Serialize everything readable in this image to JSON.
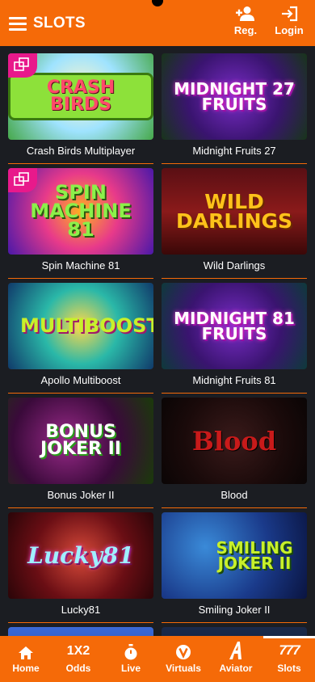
{
  "header": {
    "title": "SLOTS",
    "register_label": "Reg.",
    "login_label": "Login"
  },
  "games": [
    {
      "name": "Crash Birds Multiplayer",
      "art": "CRASH birds",
      "demo": true
    },
    {
      "name": "Midnight Fruits 27",
      "art": "MIDNIGHT 27 FRUITS",
      "demo": false
    },
    {
      "name": "Spin Machine 81",
      "art": "SPIN MACHINE 81",
      "demo": true
    },
    {
      "name": "Wild Darlings",
      "art": "WILD DARLINGS",
      "demo": false
    },
    {
      "name": "Apollo Multiboost",
      "art": "MULTIBOOST",
      "demo": false
    },
    {
      "name": "Midnight Fruits 81",
      "art": "MIDNIGHT 81 FRUITS",
      "demo": false
    },
    {
      "name": "Bonus Joker II",
      "art": "BONUS JOKER II",
      "demo": false
    },
    {
      "name": "Blood",
      "art": "Blood",
      "demo": false
    },
    {
      "name": "Lucky81",
      "art": "Lucky81",
      "demo": false
    },
    {
      "name": "Smiling Joker II",
      "art": "Smiling JOKER II",
      "demo": false
    }
  ],
  "nav": [
    {
      "label": "Home",
      "icon": "home-icon"
    },
    {
      "label": "Odds",
      "icon": "1X2"
    },
    {
      "label": "Live",
      "icon": "stopwatch-icon"
    },
    {
      "label": "Virtuals",
      "icon": "v-icon"
    },
    {
      "label": "Aviator",
      "icon": "aviator-icon"
    },
    {
      "label": "Slots",
      "icon": "777"
    }
  ],
  "colors": {
    "accent": "#f56a08",
    "background": "#1b1d22",
    "demo_badge": "#e8198b"
  }
}
